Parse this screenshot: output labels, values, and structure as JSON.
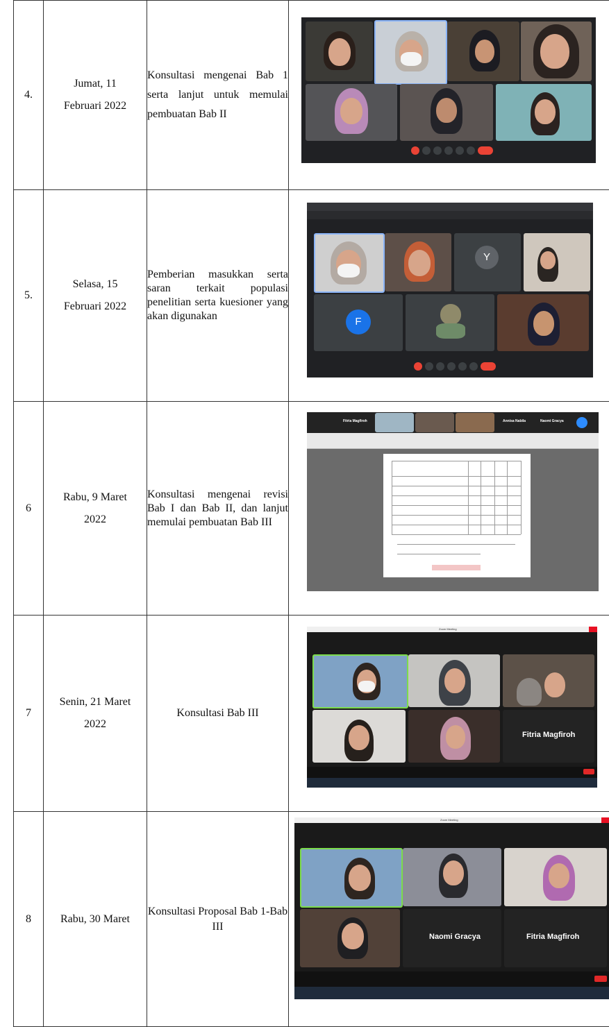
{
  "rows": [
    {
      "no": "4.",
      "date_line1": "Jumat, 11",
      "date_line2": "Februari 2022",
      "activity": "Konsultasi mengenai Bab 1 serta lanjut untuk memulai pembuatan Bab II"
    },
    {
      "no": "5.",
      "date_line1": "Selasa, 15",
      "date_line2": "Februari 2022",
      "activity": "Pemberian masukkan serta saran terkait populasi penelitian serta kuesioner yang akan digunakan"
    },
    {
      "no": "6",
      "date_line1": "Rabu, 9 Maret",
      "date_line2": "2022",
      "activity": "Konsultasi mengenai revisi Bab I dan Bab II, dan lanjut memulai pembuatan Bab III"
    },
    {
      "no": "7",
      "date_line1": "Senin, 21 Maret",
      "date_line2": "2022",
      "activity": "Konsultasi Bab III"
    },
    {
      "no": "8",
      "date_line1": "Rabu, 30 Maret",
      "date_line2": "",
      "activity": "Konsultasi Proposal Bab 1-Bab III"
    }
  ],
  "screenshots": {
    "row5": {
      "avatar_y": "Y",
      "avatar_f": "F"
    },
    "row6": {
      "name_a": "Fitria Magfiroh",
      "name_b": "Annisa Nabila",
      "name_c": "Naomi Gracya"
    },
    "row7": {
      "title": "Zoom Meeting",
      "big_name": "Fitria Magfiroh"
    },
    "row8": {
      "title": "Zoom Meeting",
      "big_name_a": "Naomi Gracya",
      "big_name_b": "Fitria Magfiroh"
    }
  },
  "colors": {
    "meet_bg": "#202124",
    "zoom_bg": "#1a1a1a",
    "accent_red": "#ea4335",
    "avatar_y": "#5f6368",
    "avatar_f": "#1a73e8"
  }
}
